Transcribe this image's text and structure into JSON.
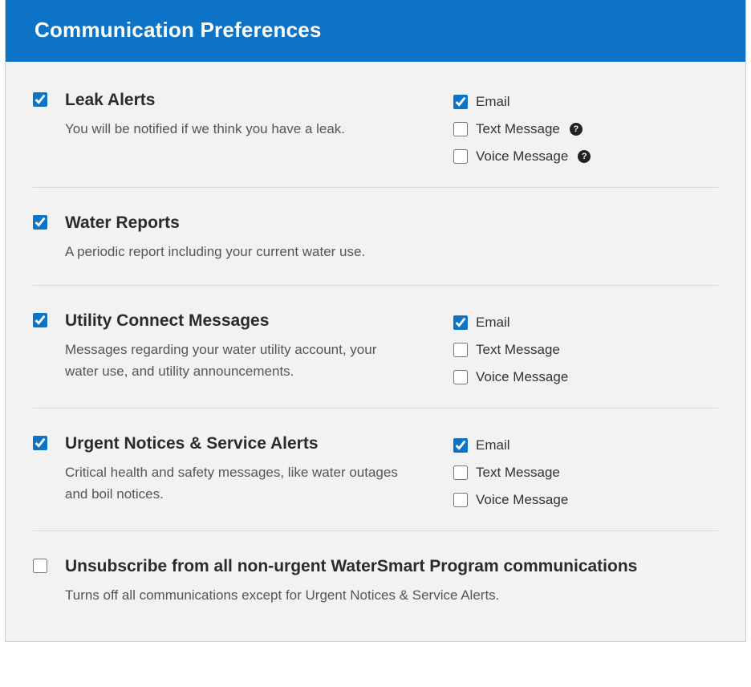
{
  "header": {
    "title": "Communication Preferences"
  },
  "labels": {
    "email": "Email",
    "text": "Text Message",
    "voice": "Voice Message"
  },
  "sections": [
    {
      "id": "leak",
      "title": "Leak Alerts",
      "desc": "You will be notified if we think you have a leak.",
      "checked": true,
      "channels": {
        "email": true,
        "text": false,
        "voice": false,
        "help_text": true,
        "help_voice": true
      }
    },
    {
      "id": "reports",
      "title": "Water Reports",
      "desc": "A periodic report including your current water use.",
      "checked": true,
      "channels": null
    },
    {
      "id": "utility",
      "title": "Utility Connect Messages",
      "desc": "Messages regarding your water utility account, your water use, and utility announcements.",
      "checked": true,
      "channels": {
        "email": true,
        "text": false,
        "voice": false,
        "help_text": false,
        "help_voice": false
      }
    },
    {
      "id": "urgent",
      "title": "Urgent Notices & Service Alerts",
      "desc": "Critical health and safety messages, like water outages and boil notices.",
      "checked": true,
      "channels": {
        "email": true,
        "text": false,
        "voice": false,
        "help_text": false,
        "help_voice": false
      }
    },
    {
      "id": "unsub",
      "title": "Unsubscribe from all non-urgent WaterSmart Program communications",
      "desc": "Turns off all communications except for Urgent Notices & Service Alerts.",
      "checked": false,
      "channels": null
    }
  ]
}
